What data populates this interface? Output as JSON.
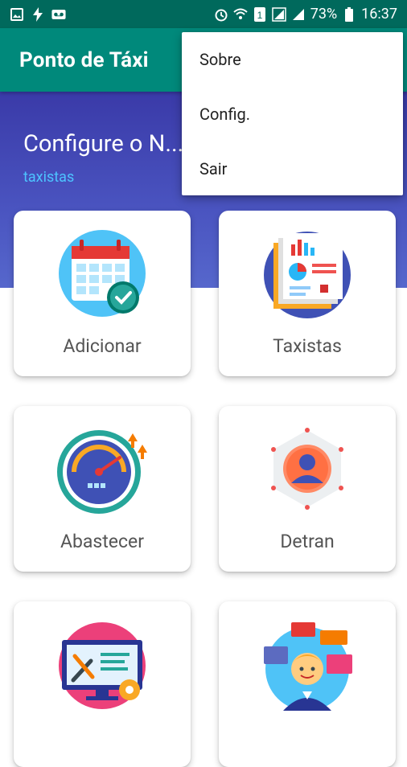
{
  "status_bar": {
    "battery_percent": "73%",
    "time": "16:37",
    "left_icons": [
      "image-icon",
      "flash-icon",
      "voicemail-icon"
    ],
    "right_icons": [
      "alarm-icon",
      "wifi-icon",
      "sim1-icon",
      "signal-icon",
      "signal2-icon",
      "battery-icon"
    ]
  },
  "app_bar": {
    "title": "Ponto de Táxi"
  },
  "header": {
    "title": "Configure o N...",
    "subtitle": "taxistas"
  },
  "menu": {
    "items": [
      "Sobre",
      "Config.",
      "Sair"
    ]
  },
  "cards": [
    {
      "label": "Adicionar",
      "icon": "calendar-check-icon"
    },
    {
      "label": "Taxistas",
      "icon": "report-chart-icon"
    },
    {
      "label": "Abastecer",
      "icon": "speedometer-icon"
    },
    {
      "label": "Detran",
      "icon": "user-hexagon-icon"
    },
    {
      "label": "",
      "icon": "computer-tools-icon"
    },
    {
      "label": "",
      "icon": "support-person-icon"
    }
  ],
  "colors": {
    "status_bar": "#00695c",
    "app_bar": "#00897b",
    "header": "#3a3aa8",
    "subtitle": "#4dc3ff"
  }
}
